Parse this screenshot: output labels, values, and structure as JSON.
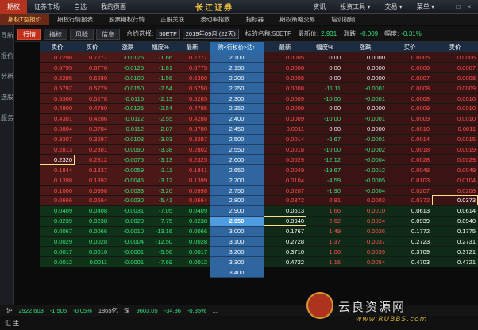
{
  "menu": {
    "items": [
      "期权",
      "证券市场",
      "自选",
      "我的页面"
    ],
    "brand": "长江证券",
    "right_items": [
      "资讯",
      "投资工具 ▾",
      "交易 ▾",
      "菜单 ▾"
    ],
    "window_buttons": [
      "_",
      "□",
      "×"
    ]
  },
  "tabs": [
    "期权T型报价",
    "期权行情报表",
    "股票期权行情",
    "正股关联",
    "波动率指数",
    "指标器",
    "期权策略交易",
    "培训视频"
  ],
  "sidebar": [
    "导航",
    "报价",
    "分析",
    "选股",
    "服务"
  ],
  "toolbar": {
    "buttons": [
      "行情",
      "指标",
      "风险",
      "信息"
    ],
    "contract_label": "合约选择:",
    "contract_value": "50ETF",
    "month_value": "2019年09月 (22天)",
    "underlying_label": "标的名称:50ETF",
    "last_label": "最新价:",
    "last_value": "2.931",
    "change_label": "涨跌:",
    "change_value": "-0.009",
    "amp_label": "幅度:",
    "amp_value": "-0.31%"
  },
  "call_headers": [
    "卖价",
    "买价",
    "涨跌",
    "幅度%",
    "最新"
  ],
  "strike_header": "购<行权价>沽↑",
  "put_headers": [
    "最新",
    "幅度%",
    "涨跌",
    "买价",
    "卖价"
  ],
  "rows": [
    {
      "call": [
        "0.7298",
        "0.7277",
        "-0.0125",
        "-1.66",
        "0.7277"
      ],
      "strike": "2.100",
      "put": [
        "0.0005",
        "0.00",
        "0.0000",
        "0.0005",
        "0.0006"
      ],
      "side": "red"
    },
    {
      "call": [
        "0.6795",
        "0.6776",
        "-0.0125",
        "-1.81",
        "0.6775"
      ],
      "strike": "2.150",
      "put": [
        "0.0006",
        "0.00",
        "0.0000",
        "0.0006",
        "0.0007"
      ],
      "side": "red"
    },
    {
      "call": [
        "0.6295",
        "0.6280",
        "-0.0100",
        "-1.56",
        "0.6300"
      ],
      "strike": "2.200",
      "put": [
        "0.0008",
        "0.00",
        "0.0000",
        "0.0007",
        "0.0008"
      ],
      "side": "red"
    },
    {
      "call": [
        "0.5797",
        "0.5779",
        "-0.0150",
        "-2.54",
        "0.5750"
      ],
      "strike": "2.250",
      "put": [
        "0.0008",
        "-11.11",
        "-0.0001",
        "0.0008",
        "0.0009"
      ],
      "side": "red"
    },
    {
      "call": [
        "0.5300",
        "0.5278",
        "-0.0115",
        "-2.13",
        "0.5285"
      ],
      "strike": "2.300",
      "put": [
        "0.0009",
        "-10.00",
        "-0.0001",
        "0.0008",
        "0.0010"
      ],
      "side": "red"
    },
    {
      "call": [
        "0.4800",
        "0.4780",
        "-0.0125",
        "-2.54",
        "0.4795"
      ],
      "strike": "2.350",
      "put": [
        "0.0009",
        "0.00",
        "0.0000",
        "0.0009",
        "0.0010"
      ],
      "side": "red"
    },
    {
      "call": [
        "0.4301",
        "0.4286",
        "-0.0112",
        "-2.55",
        "0.4288"
      ],
      "strike": "2.400",
      "put": [
        "0.0009",
        "-10.00",
        "-0.0001",
        "0.0009",
        "0.0010"
      ],
      "side": "red"
    },
    {
      "call": [
        "0.3804",
        "0.3784",
        "-0.0112",
        "-2.87",
        "0.3780"
      ],
      "strike": "2.450",
      "put": [
        "0.0011",
        "0.00",
        "0.0000",
        "0.0010",
        "0.0011"
      ],
      "side": "red"
    },
    {
      "call": [
        "0.3307",
        "0.3297",
        "-0.0103",
        "-3.03",
        "0.3297"
      ],
      "strike": "2.500",
      "put": [
        "0.0014",
        "-6.67",
        "-0.0001",
        "0.0014",
        "0.0015"
      ],
      "side": "red"
    },
    {
      "call": [
        "0.2813",
        "0.2801",
        "-0.0090",
        "-3.38",
        "0.2802"
      ],
      "strike": "2.550",
      "put": [
        "0.0018",
        "-10.00",
        "-0.0002",
        "0.0018",
        "0.0019"
      ],
      "side": "red"
    },
    {
      "call": [
        "0.2320",
        "0.2312",
        "-0.0075",
        "-3.13",
        "0.2325"
      ],
      "strike": "2.600",
      "put": [
        "0.0029",
        "-12.12",
        "-0.0004",
        "0.0028",
        "0.0029"
      ],
      "side": "red"
    },
    {
      "call": [
        "0.1844",
        "0.1837",
        "-0.0059",
        "-3.11",
        "0.1841"
      ],
      "strike": "2.650",
      "put": [
        "0.0049",
        "-19.67",
        "-0.0012",
        "0.0048",
        "0.0049"
      ],
      "side": "red"
    },
    {
      "call": [
        "0.1398",
        "0.1392",
        "-0.0045",
        "-3.12",
        "0.1399"
      ],
      "strike": "2.700",
      "put": [
        "0.0104",
        "-4.59",
        "-0.0005",
        "0.0103",
        "0.0104"
      ],
      "side": "red"
    },
    {
      "call": [
        "0.1000",
        "0.0998",
        "-0.0033",
        "-3.20",
        "0.0998"
      ],
      "strike": "2.750",
      "put": [
        "0.0207",
        "-1.90",
        "-0.0004",
        "0.0207",
        "0.0208"
      ],
      "side": "red"
    },
    {
      "call": [
        "0.0666",
        "0.0664",
        "-0.0030",
        "-5.41",
        "0.0664"
      ],
      "strike": "2.800",
      "put": [
        "0.0372",
        "0.81",
        "0.0003",
        "0.0372",
        "0.0373"
      ],
      "side": "red"
    },
    {
      "call": [
        "0.0409",
        "0.0408",
        "-0.0031",
        "-7.05",
        "0.0409"
      ],
      "strike": "2.900",
      "put": [
        "0.0613",
        "1.66",
        "0.0010",
        "0.0613",
        "0.0614"
      ],
      "side": "green"
    },
    {
      "call": [
        "0.0239",
        "0.0238",
        "-0.0020",
        "-7.75",
        "0.0238"
      ],
      "strike": "2.950",
      "put": [
        "0.0940",
        "2.62",
        "0.0024",
        "0.0939",
        "0.0940"
      ],
      "side": "green",
      "atm": true
    },
    {
      "call": [
        "0.0067",
        "0.0066",
        "-0.0010",
        "-13.16",
        "0.0066"
      ],
      "strike": "3.000",
      "put": [
        "0.1767",
        "1.49",
        "0.0026",
        "0.1772",
        "0.1775"
      ],
      "side": "green"
    },
    {
      "call": [
        "0.0029",
        "0.0028",
        "-0.0004",
        "-12.50",
        "0.0028"
      ],
      "strike": "3.100",
      "put": [
        "0.2728",
        "1.37",
        "0.0037",
        "0.2723",
        "0.2731"
      ],
      "side": "green"
    },
    {
      "call": [
        "0.0017",
        "0.0016",
        "-0.0001",
        "-5.56",
        "0.0017"
      ],
      "strike": "3.200",
      "put": [
        "0.3710",
        "1.06",
        "0.0039",
        "0.3709",
        "0.3721"
      ],
      "side": "green"
    },
    {
      "call": [
        "0.0012",
        "0.0011",
        "-0.0001",
        "-7.69",
        "0.0012"
      ],
      "strike": "3.300",
      "put": [
        "0.4722",
        "1.16",
        "0.0054",
        "0.4703",
        "0.4721"
      ],
      "side": "green"
    }
  ],
  "extra_strike": "3.400",
  "status": {
    "index1": "沪",
    "index1_val": "2922.603",
    "index1_chg": "-1.505",
    "index1_pct": "-0.05%",
    "index1_vol": "1865亿",
    "index2": "深",
    "index2_val": "9603.05",
    "index2_chg": "-34.36",
    "index2_pct": "-0.35%",
    "index2_vol": "...",
    "bottom_label": "汇 主"
  },
  "watermark": {
    "site_name": "云良资源网",
    "site_url": "www.RUBBS.com"
  }
}
